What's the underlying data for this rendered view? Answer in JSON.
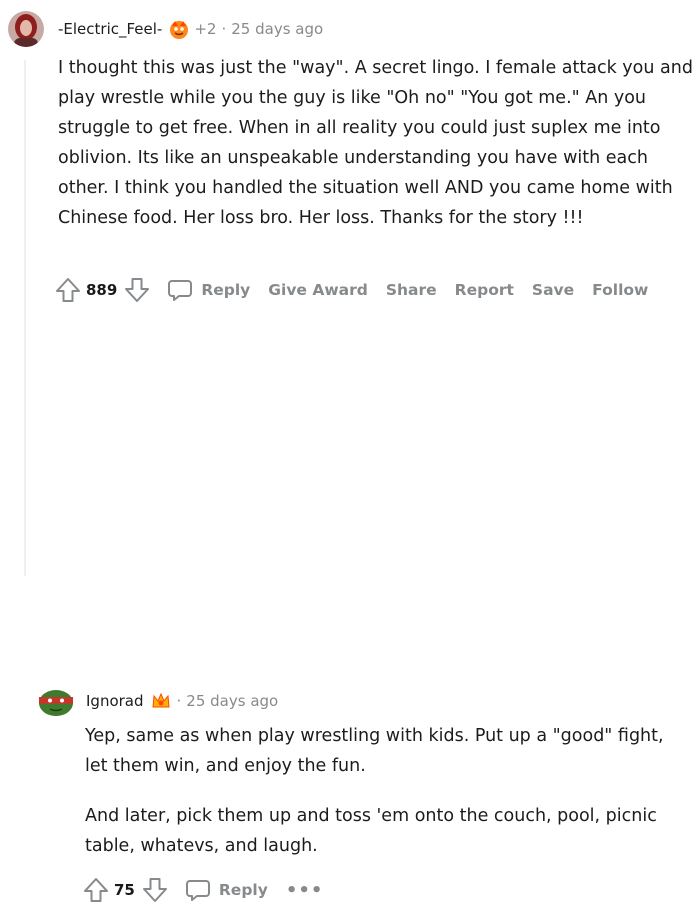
{
  "colors": {
    "meta_gray": "#878a8c",
    "text": "#1c1c1c",
    "thread_line": "#edeff1"
  },
  "comments": [
    {
      "username": "-Electric_Feel-",
      "award_icon": "award-icon",
      "award_count": "+2",
      "separator": "·",
      "timestamp": "25 days ago",
      "body": "I thought this was just the \"way\". A secret lingo. I female attack you and play wrestle while you the guy is like \"Oh no\" \"You got me.\" An you struggle to get free. When in all reality you could just suplex me into oblivion. Its like an unspeakable understanding you have with each other. I think you handled the situation well AND you came home with Chinese food. Her loss bro. Her loss. Thanks for the story !!!",
      "score": "889",
      "actions": {
        "reply": "Reply",
        "give_award": "Give Award",
        "share": "Share",
        "report": "Report",
        "save": "Save",
        "follow": "Follow"
      }
    },
    {
      "username": "Ignorad",
      "award_icon": "award-icon",
      "separator": "·",
      "timestamp": "25 days ago",
      "body_paragraphs": [
        "Yep, same as when play wrestling with kids. Put up a \"good\" fight, let them win, and enjoy the fun.",
        "And later, pick them up and toss 'em onto the couch, pool, picnic table, whatevs, and laugh."
      ],
      "score": "75",
      "actions": {
        "reply": "Reply",
        "more": "•••"
      }
    }
  ]
}
